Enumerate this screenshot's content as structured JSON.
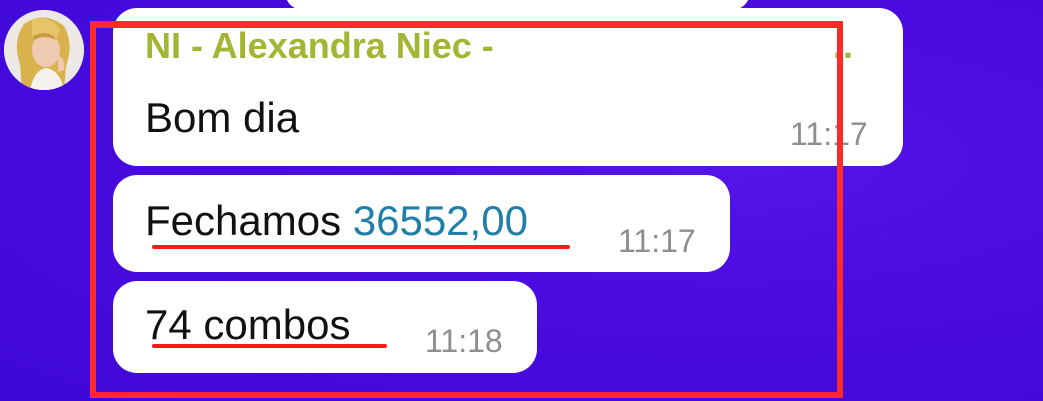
{
  "chat": {
    "sender_name": "NI - Alexandra Niec -",
    "sender_truncation": "..",
    "messages": [
      {
        "text": "Bom dia",
        "time": "11:17"
      },
      {
        "text_prefix": "Fechamos ",
        "amount": "36552,00",
        "time": "11:17"
      },
      {
        "text": "74 combos",
        "time": "11:18"
      }
    ]
  },
  "colors": {
    "background": "#4a0be0",
    "sender_name": "#a4b533",
    "amount_link": "#1f7fa8",
    "annotation": "#ff2a2a"
  },
  "icons": {
    "avatar": "user-avatar-photo"
  }
}
